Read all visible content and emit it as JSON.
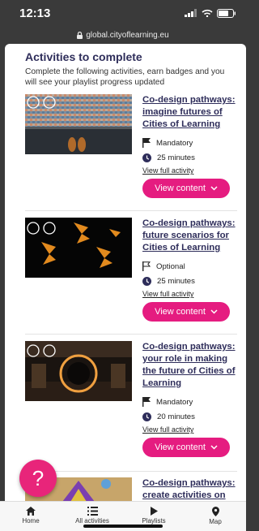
{
  "status_bar": {
    "time": "12:13"
  },
  "browser": {
    "url": "global.cityoflearning.eu"
  },
  "section": {
    "heading": "Activities to complete",
    "intro": "Complete the following activities, earn badges and you will see your playlist progress updated"
  },
  "activities": [
    {
      "title": "Co-design pathways: imagine futures of Cities of Learning",
      "requirement": "Mandatory",
      "duration": "25 minutes",
      "link": "View full activity",
      "button": "View content"
    },
    {
      "title": "Co-design pathways: future scenarios for Cities of Learning",
      "requirement": "Optional",
      "duration": "25 minutes",
      "link": "View full activity",
      "button": "View content"
    },
    {
      "title": "Co-design pathways: your role in making the future of Cities of Learning",
      "requirement": "Mandatory",
      "duration": "20 minutes",
      "link": "View full activity",
      "button": "View content"
    },
    {
      "title": "Co-design pathways: create activities on"
    }
  ],
  "help_button": {
    "label": "?"
  },
  "bottom_nav": {
    "home": "Home",
    "all_activities": "All activities",
    "playlists": "Playlists",
    "map": "Map"
  },
  "colors": {
    "accent": "#e51c80",
    "heading": "#2e2d5a"
  }
}
